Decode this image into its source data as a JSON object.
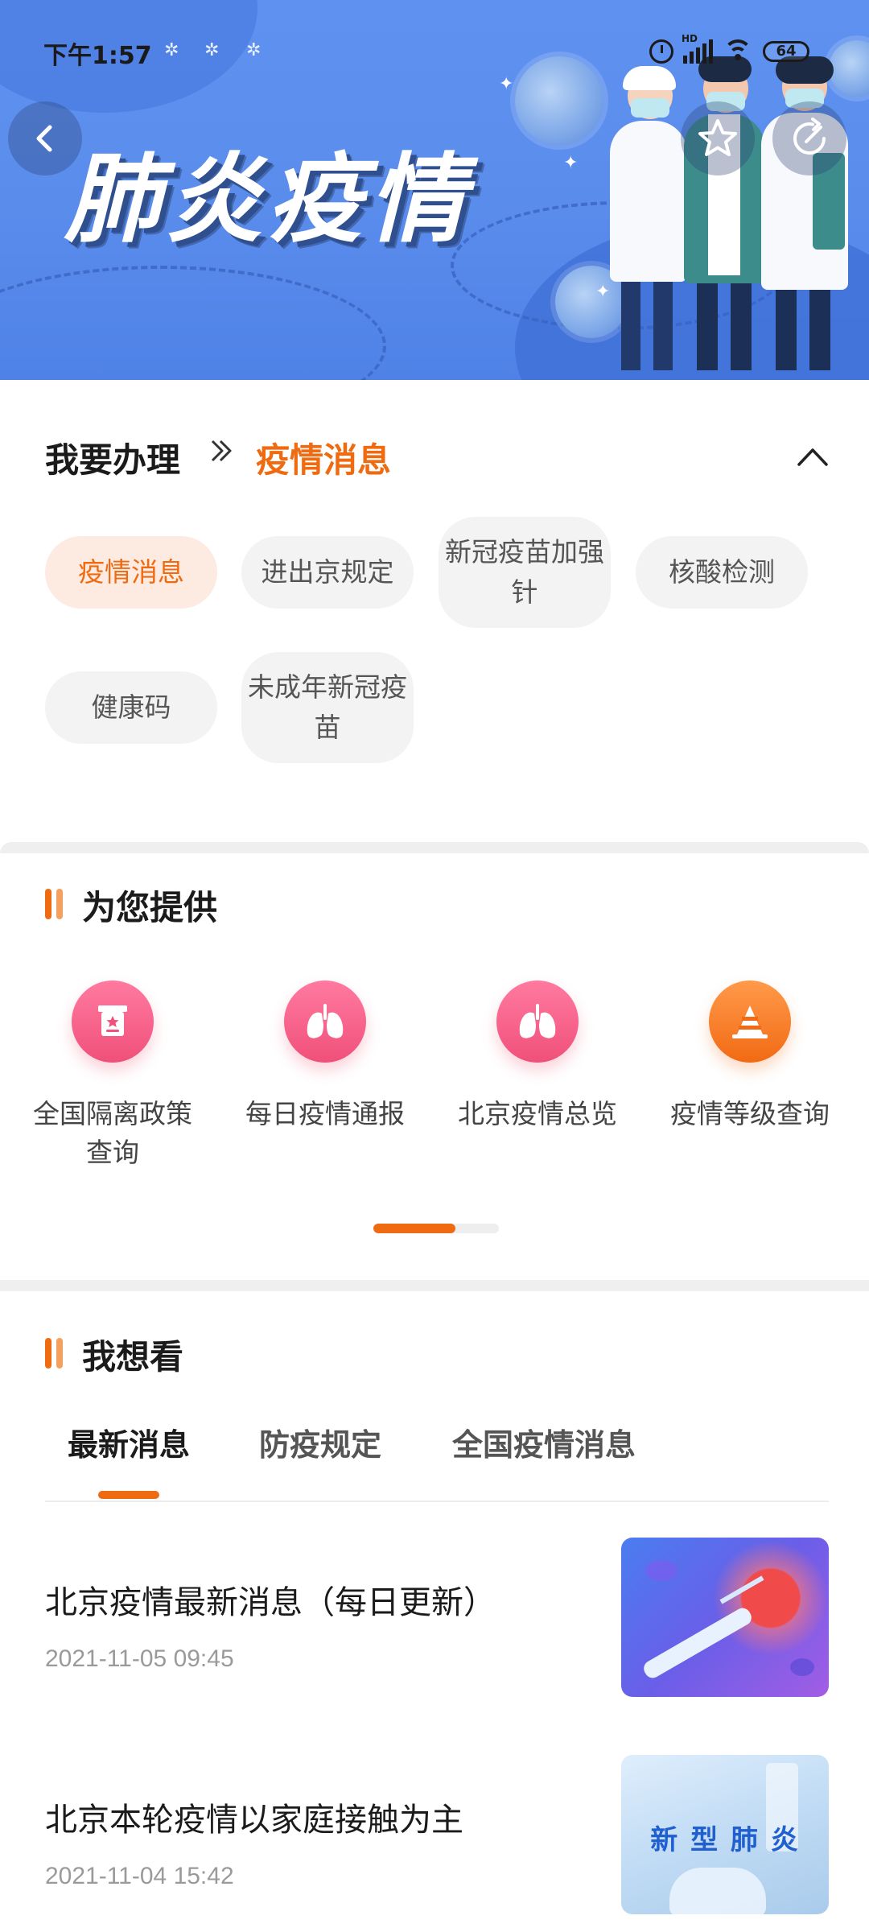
{
  "status_bar": {
    "time": "下午1:57",
    "network_badge": "HD",
    "battery": "64"
  },
  "banner": {
    "title": "肺炎疫情",
    "colors": {
      "background": "#5a8cec",
      "title_shadow": "#2f4f8f"
    }
  },
  "handle": {
    "title": "我要办理",
    "current": "疫情消息",
    "chips": [
      {
        "label": "疫情消息",
        "active": true
      },
      {
        "label": "进出京规定",
        "active": false
      },
      {
        "label": "新冠疫苗加强针",
        "active": false
      },
      {
        "label": "核酸检测",
        "active": false
      },
      {
        "label": "健康码",
        "active": false
      },
      {
        "label": "未成年新冠疫苗",
        "active": false
      }
    ]
  },
  "services": {
    "title": "为您提供",
    "items": [
      {
        "label": "全国隔离政策查询",
        "icon": "policy-icon"
      },
      {
        "label": "每日疫情通报",
        "icon": "lungs-icon"
      },
      {
        "label": "北京疫情总览",
        "icon": "lungs-icon"
      },
      {
        "label": "疫情等级查询",
        "icon": "cone-icon"
      }
    ],
    "pager": {
      "pages": 2,
      "current": 1
    }
  },
  "watch": {
    "title": "我想看",
    "tabs": [
      {
        "label": "最新消息",
        "active": true
      },
      {
        "label": "防疫规定",
        "active": false
      },
      {
        "label": "全国疫情消息",
        "active": false
      }
    ],
    "news": [
      {
        "title": "北京疫情最新消息（每日更新）",
        "time": "2021-11-05 09:45"
      },
      {
        "title": "北京本轮疫情以家庭接触为主",
        "time": "2021-11-04 15:42",
        "thumb_text": "新 型 肺 炎"
      }
    ]
  },
  "colors": {
    "accent": "#ef6b12",
    "accent_light": "#fdeae1",
    "pink": "#f0507a"
  }
}
